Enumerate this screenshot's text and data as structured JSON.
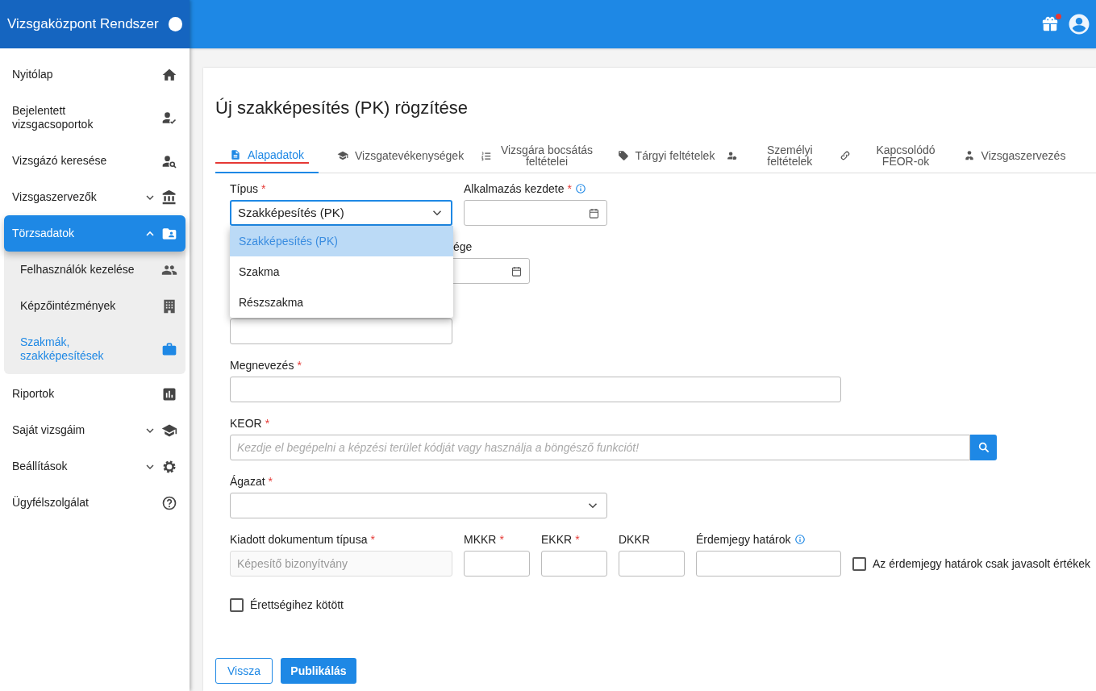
{
  "header": {
    "title": "Vizsgaközpont Rendszer",
    "notification_dot": true
  },
  "sidebar": {
    "items": [
      {
        "label": "Nyitólap",
        "selected": false
      },
      {
        "label": "Bejelentett vizsgacsoportok",
        "selected": false
      },
      {
        "label": "Vizsgázó keresése",
        "selected": false
      },
      {
        "label": "Vizsgaszervezők",
        "selected": false,
        "expanded": false
      },
      {
        "label": "Törzsadatok",
        "selected": true,
        "expanded": true,
        "children": [
          {
            "label": "Felhasználók kezelése",
            "selected": false
          },
          {
            "label": "Képzőintézmények",
            "selected": false
          },
          {
            "label": "Szakmák, szakképesítések",
            "selected": true
          }
        ]
      },
      {
        "label": "Riportok",
        "selected": false
      },
      {
        "label": "Saját vizsgáim",
        "selected": false,
        "expanded": false
      },
      {
        "label": "Beállítások",
        "selected": false,
        "expanded": false
      },
      {
        "label": "Ügyfélszolgálat",
        "selected": false
      }
    ]
  },
  "page": {
    "title": "Új szakképesítés (PK) rögzítése",
    "tabs": [
      {
        "label": "Alapadatok",
        "selected": true
      },
      {
        "label": "Vizsgatevékenységek",
        "selected": false
      },
      {
        "label": "Vizsgára bocsátás feltételei",
        "selected": false
      },
      {
        "label": "Tárgyi feltételek",
        "selected": false
      },
      {
        "label": "Személyi feltételek",
        "selected": false
      },
      {
        "label": "Kapcsolódó FEOR-ok",
        "selected": false
      },
      {
        "label": "Vizsgaszervezés",
        "selected": false
      }
    ],
    "form": {
      "type_field": {
        "label": "Típus",
        "required": "*",
        "value": "Szakképesítés (PK)",
        "expanded": true,
        "options": [
          {
            "label": "Szakképesítés (PK)",
            "selected": true
          },
          {
            "label": "Szakma",
            "selected": false
          },
          {
            "label": "Részszakma",
            "selected": false
          }
        ]
      },
      "start_date_field": {
        "label": "Alkalmazás kezdete",
        "required": "*"
      },
      "end_date_field": {
        "label": "ége"
      },
      "name_field": {
        "label": "Megnevezés",
        "required": "*"
      },
      "keor_field": {
        "label": "KEOR",
        "required": "*",
        "placeholder": "Kezdje el begépelni a képzési terület kódját vagy használja a böngésző funkciót!"
      },
      "sector_field": {
        "label": "Ágazat",
        "required": "*"
      },
      "document_type_field": {
        "label": "Kiadott dokumentum típusa",
        "required": "*",
        "value": "Képesítő bizonyítvány",
        "disabled": true
      },
      "mkkr_field": {
        "label": "MKKR",
        "required": "*"
      },
      "ekkr_field": {
        "label": "EKKR",
        "required": "*"
      },
      "dkkr_field": {
        "label": "DKKR"
      },
      "grade_limits_field": {
        "label": "Érdemjegy határok"
      },
      "suggested_checkbox": {
        "label": "Az érdemjegy határok csak javasolt értékek",
        "checked": false
      },
      "matura_checkbox": {
        "label": "Érettségihez kötött",
        "checked": false
      }
    },
    "buttons": [
      {
        "label": "Vissza",
        "kind": "outline"
      },
      {
        "label": "Publikálás",
        "kind": "primary"
      }
    ]
  }
}
